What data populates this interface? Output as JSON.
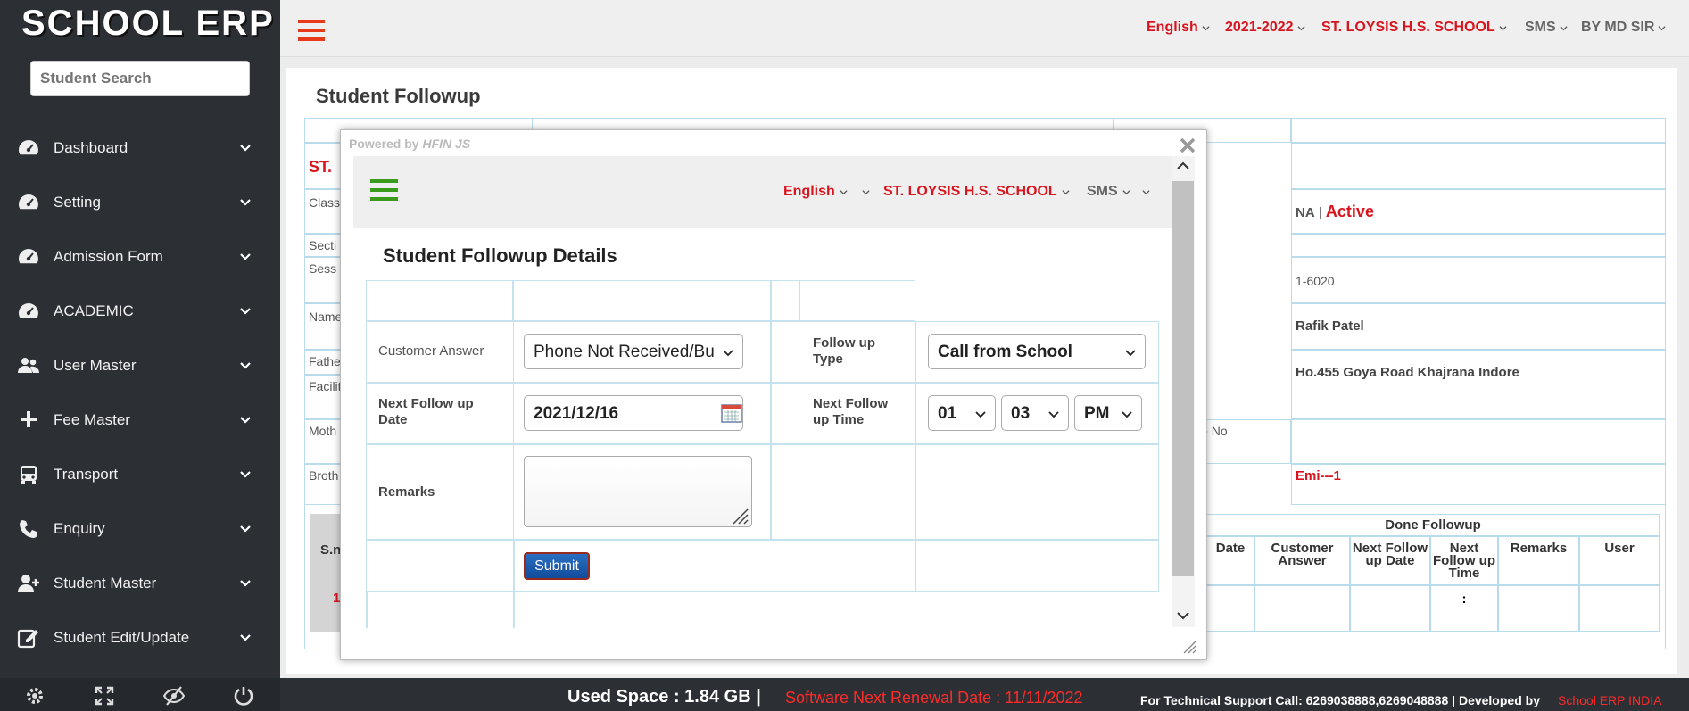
{
  "app": {
    "logo": "SCHOOL ERP",
    "search_placeholder": "Student Search"
  },
  "sidebar": {
    "items": [
      {
        "label": "Dashboard",
        "icon": "dashboard-icon"
      },
      {
        "label": "Setting",
        "icon": "dashboard-icon"
      },
      {
        "label": "Admission Form",
        "icon": "dashboard-icon"
      },
      {
        "label": "ACADEMIC",
        "icon": "dashboard-icon"
      },
      {
        "label": "User Master",
        "icon": "users-icon"
      },
      {
        "label": "Fee Master",
        "icon": "plus-icon"
      },
      {
        "label": "Transport",
        "icon": "bus-icon"
      },
      {
        "label": "Enquiry",
        "icon": "phone-icon"
      },
      {
        "label": "Student Master",
        "icon": "user-plus-icon"
      },
      {
        "label": "Student Edit/Update",
        "icon": "edit-icon"
      }
    ],
    "bottom_icons": [
      "gear-icon",
      "fullscreen-icon",
      "eye-slash-icon",
      "power-icon"
    ]
  },
  "topbar": {
    "language": "English",
    "session": "2021-2022",
    "school": "ST. LOYSIS H.S. SCHOOL",
    "sms": "SMS",
    "user": "BY MD SIR"
  },
  "page": {
    "title": "Student Followup"
  },
  "background": {
    "school_partial": "ST.",
    "labels": [
      "Class",
      "Secti",
      "Sess",
      "Name",
      "Fathe",
      "Facilit",
      "Moth",
      "Broth"
    ],
    "status_na": "NA",
    "status_sep": "|",
    "status_active": "Active",
    "reg_no": "1-6020",
    "father_name": "Rafik Patel",
    "address": "Ho.455 Goya Road Khajrana Indore",
    "mobile_label": "le No",
    "emi": "Emi---1",
    "snum_head": "S.n",
    "snum_val": "1",
    "done_followup": "Done Followup",
    "done_cols": [
      "Date",
      "Customer Answer",
      "Next Follow up Date",
      "Next Follow up Time",
      "Remarks",
      "User"
    ],
    "done_time_val": ":"
  },
  "modal": {
    "powered_prefix": "Powered by",
    "powered_name": "HFIN JS",
    "language": "English",
    "school": "ST. LOYSIS H.S. SCHOOL",
    "sms": "SMS",
    "title": "Student Followup Details",
    "form": {
      "customer_answer_label": "Customer Answer",
      "customer_answer_value": "Phone Not Received/Bu",
      "followup_type_label": "Follow up Type",
      "followup_type_value": "Call from School",
      "next_date_label": "Next Follow up Date",
      "next_date_value": "2021/12/16",
      "next_time_label": "Next Follow up Time",
      "hour": "01",
      "minute": "03",
      "ampm": "PM",
      "remarks_label": "Remarks",
      "remarks_value": "",
      "submit_label": "Submit"
    }
  },
  "footer": {
    "used_space": "Used Space : 1.84 GB |",
    "renewal": "Software Next Renewal Date : 11/11/2022",
    "support": "For Technical Support Call: 6269038888,6269048888 | Developed by",
    "developer": "School ERP INDIA"
  },
  "colors": {
    "accent_red": "#e8391a",
    "sidebar_bg": "#2c2f33",
    "green": "#3a9a1c",
    "border_blue": "#b9dcec"
  }
}
